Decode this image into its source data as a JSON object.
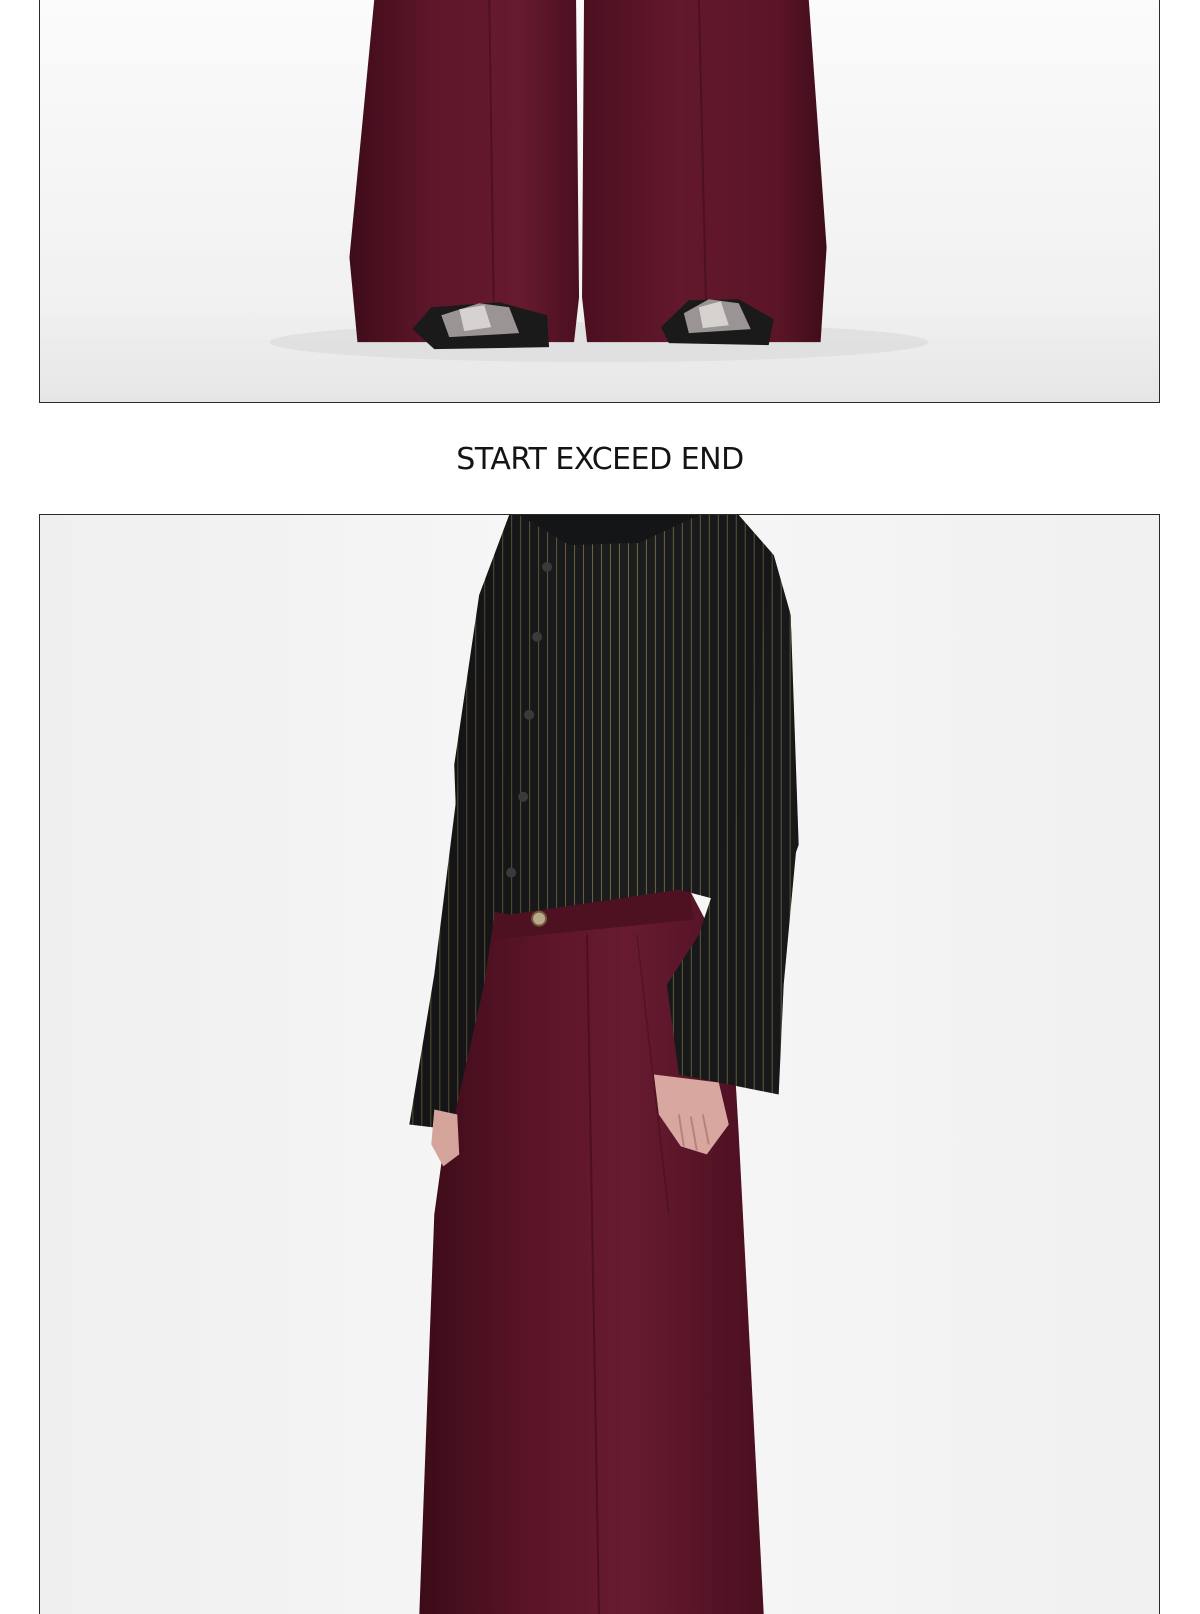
{
  "caption": {
    "text": "START EXCEED END"
  },
  "photos": [
    {
      "subject": "wide-leg burgundy trousers with silver-toed black shoes"
    },
    {
      "subject": "black pinstripe shirt over burgundy pleated wide-leg trousers"
    }
  ],
  "colors": {
    "background": "#ffffff",
    "photo_backdrop": "#f3f3f3",
    "frame_border": "#2a2a2a",
    "trouser_burgundy": "#5a1428",
    "shirt_black": "#1c1d1f",
    "pinstripe": "#8c7a4a",
    "skin": "#d8a8a0"
  }
}
